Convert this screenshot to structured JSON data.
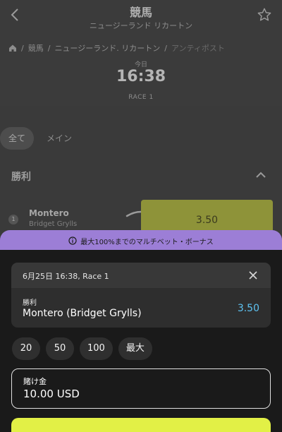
{
  "header": {
    "title": "競馬",
    "subtitle": "ニュージーランド リカートン"
  },
  "breadcrumb": {
    "items": [
      "競馬",
      "ニュージーランド. リカートン",
      "アンティポスト"
    ],
    "separator": "/"
  },
  "event": {
    "day_label": "今日",
    "time": "16:38",
    "race_label": "RACE 1"
  },
  "filters": {
    "all": "全て",
    "main": "メイン"
  },
  "market": {
    "title": "勝利"
  },
  "runner": {
    "number": "1",
    "name": "Montero",
    "jockey": "Bridget Grylls",
    "odds": "3.50"
  },
  "bonus_banner": {
    "text": "最大100%までのマルチベット・ボーナス"
  },
  "bet_slip": {
    "event_line": "6月25日 16:38, Race 1",
    "market": "勝利",
    "selection": "Montero (Bridget Grylls)",
    "odds": "3.50",
    "quick_stakes": [
      "20",
      "50",
      "100",
      "最大"
    ],
    "stake_label": "賭け金",
    "stake_value": "10.00 USD"
  },
  "icons": {
    "back": "chevron-left-icon",
    "favorite": "star-icon",
    "home": "home-icon",
    "collapse": "chevron-up-icon",
    "info": "info-icon",
    "close": "close-icon"
  },
  "colors": {
    "accent_yellow": "#e2f046",
    "bonus_purple": "#9c7ed6",
    "odds_blue": "#5ec3f2"
  }
}
